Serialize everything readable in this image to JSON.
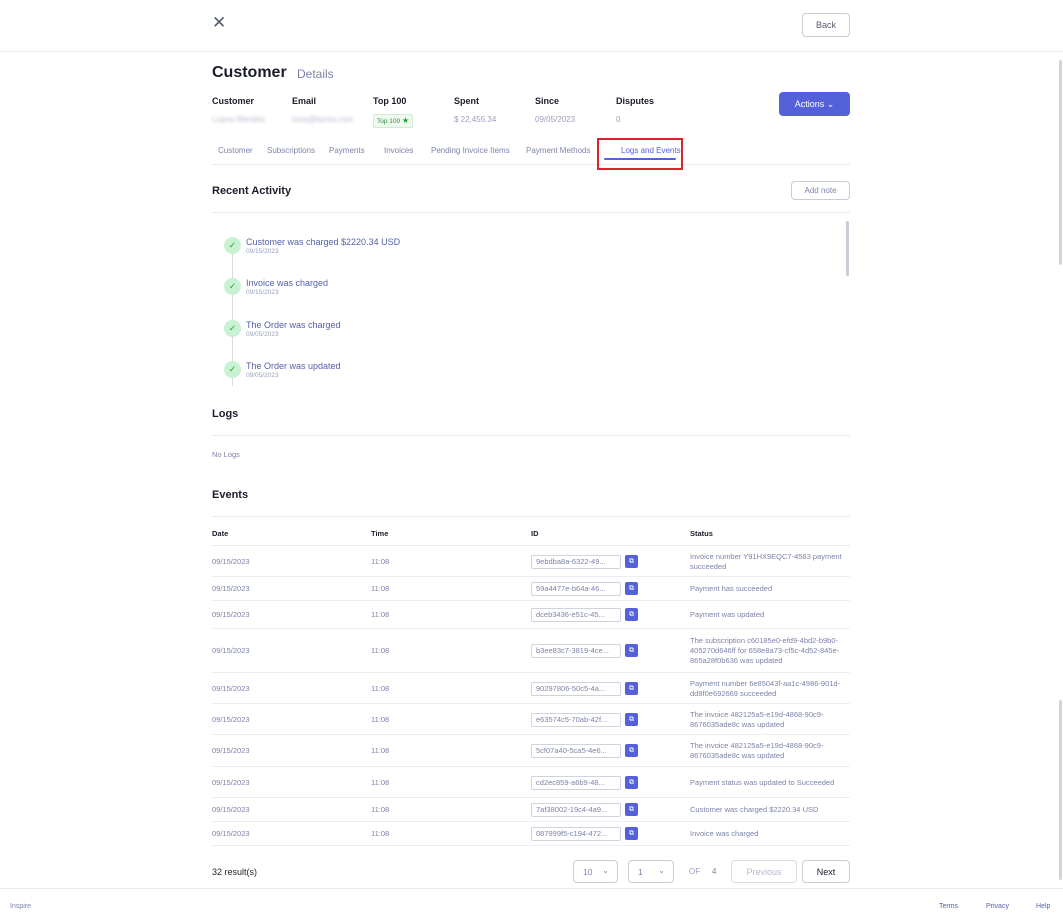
{
  "header": {
    "close_icon": "close-icon",
    "back_label": "Back"
  },
  "page": {
    "title": "Customer",
    "subtitle": "Details"
  },
  "summary": {
    "customer": {
      "label": "Customer",
      "value": "Luana Mendes"
    },
    "email": {
      "label": "Email",
      "value": "lovis@terms.com"
    },
    "top100": {
      "label": "Top 100",
      "badge": "Top 100",
      "badge_icon": "star-icon"
    },
    "spent": {
      "label": "Spent",
      "value": "$ 22,455.34"
    },
    "since": {
      "label": "Since",
      "value": "09/05/2023"
    },
    "disputes": {
      "label": "Disputes",
      "value": "0"
    }
  },
  "actions": {
    "label": "Actions",
    "icon": "chevron-down-icon"
  },
  "tabs": [
    {
      "label": "Customer"
    },
    {
      "label": "Subscriptions"
    },
    {
      "label": "Payments"
    },
    {
      "label": "Invoices"
    },
    {
      "label": "Pending Invoice Items"
    },
    {
      "label": "Payment Methods"
    },
    {
      "label": "Logs and Events",
      "active": true
    }
  ],
  "recent_activity": {
    "heading": "Recent Activity",
    "add_note_label": "Add note",
    "items": [
      {
        "title": "Customer was charged $2220.34 USD",
        "date": "09/15/2023"
      },
      {
        "title": "Invoice was charged",
        "date": "09/15/2023"
      },
      {
        "title": "The Order was charged",
        "date": "09/05/2023"
      },
      {
        "title": "The Order was updated",
        "date": "09/05/2023"
      }
    ]
  },
  "logs": {
    "heading": "Logs",
    "empty_text": "No Logs"
  },
  "events": {
    "heading": "Events",
    "columns": [
      "Date",
      "Time",
      "ID",
      "Status"
    ],
    "rows": [
      {
        "date": "09/15/2023",
        "time": "11:08",
        "id": "9ebdba8a-6322-49...",
        "status": "Invoice number Y91HX9EQC7-4583 payment succeeded"
      },
      {
        "date": "09/15/2023",
        "time": "11:08",
        "id": "59a4477e-b64a-46...",
        "status": "Payment has succeeded"
      },
      {
        "date": "09/15/2023",
        "time": "11:08",
        "id": "dceb3436-e51c-45...",
        "status": "Payment was updated"
      },
      {
        "date": "09/15/2023",
        "time": "11:08",
        "id": "b3ee83c7-3819-4ce...",
        "status": "The subscription c60185e0-efd9-4bd2-b9b0-405270d646ff for 658e8a73-cf5c-4d52-845e-865a28f0b636 was updated"
      },
      {
        "date": "09/15/2023",
        "time": "11:08",
        "id": "90297806-50c5-4a...",
        "status": "Payment number 6e85043f-aa1c-4986-901d-dd8f0e692669 succeeded"
      },
      {
        "date": "09/15/2023",
        "time": "11:08",
        "id": "e63574c5-70ab-42f...",
        "status": "The invoice 482125a5-e19d-4868-90c9-8676035ade8c was updated"
      },
      {
        "date": "09/15/2023",
        "time": "11:08",
        "id": "5cf07a40-5ca5-4e6...",
        "status": "The invoice 482125a5-e19d-4868-90c9-8676035ade8c was updated"
      },
      {
        "date": "09/15/2023",
        "time": "11:08",
        "id": "cd2ec859-a6b9-48...",
        "status": "Payment status was updated to Succeeded"
      },
      {
        "date": "09/15/2023",
        "time": "11:08",
        "id": "7af38002-19c4-4a9...",
        "status": "Customer was charged $2220.34 USD"
      },
      {
        "date": "09/15/2023",
        "time": "11:08",
        "id": "087999f5-c194-472...",
        "status": "Invoice was charged"
      }
    ]
  },
  "pagination": {
    "results": "32 result(s)",
    "page_size": "10",
    "page": "1",
    "of_label": "OF",
    "total_pages": "4",
    "previous_label": "Previous",
    "next_label": "Next"
  },
  "footer": {
    "brand": "Inspire",
    "links": [
      "Terms",
      "Privacy",
      "Help"
    ]
  },
  "colors": {
    "accent": "#5561d8",
    "success": "#2e9e48",
    "highlight": "#d8242a"
  }
}
